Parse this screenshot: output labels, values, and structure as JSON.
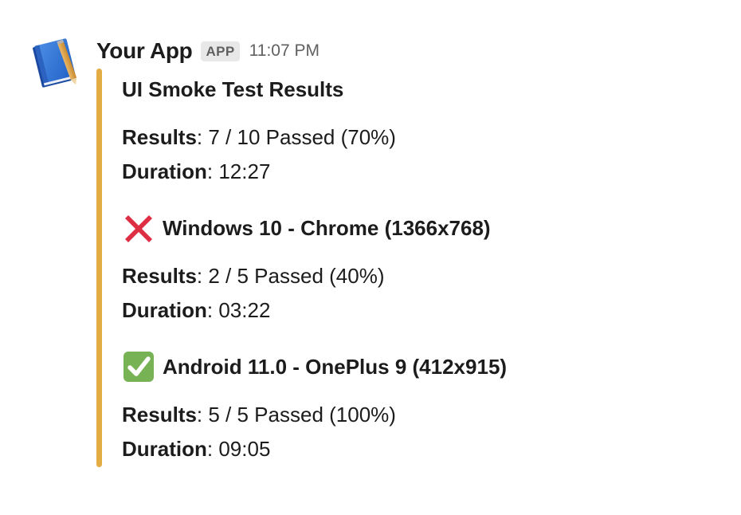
{
  "message": {
    "app_name": "Your App",
    "badge": "APP",
    "time": "11:07 PM",
    "accent_color": "#e3ad43"
  },
  "attachment": {
    "title": "UI Smoke Test Results",
    "summary": {
      "results_label": "Results",
      "results_value": ": 7 / 10 Passed (70%)",
      "duration_label": "Duration",
      "duration_value": ":  12:27"
    },
    "sections": [
      {
        "status": "failed",
        "icon": "red-x-icon",
        "heading": "Windows 10 - Chrome (1366x768)",
        "results_label": "Results",
        "results_value": ": 2 / 5 Passed (40%)",
        "duration_label": "Duration",
        "duration_value": ":  03:22"
      },
      {
        "status": "passed",
        "icon": "green-check-icon",
        "heading": "Android 11.0 - OnePlus 9 (412x915)",
        "results_label": "Results",
        "results_value": ": 5 / 5 Passed (100%)",
        "duration_label": "Duration",
        "duration_value": ":  09:05"
      }
    ]
  }
}
